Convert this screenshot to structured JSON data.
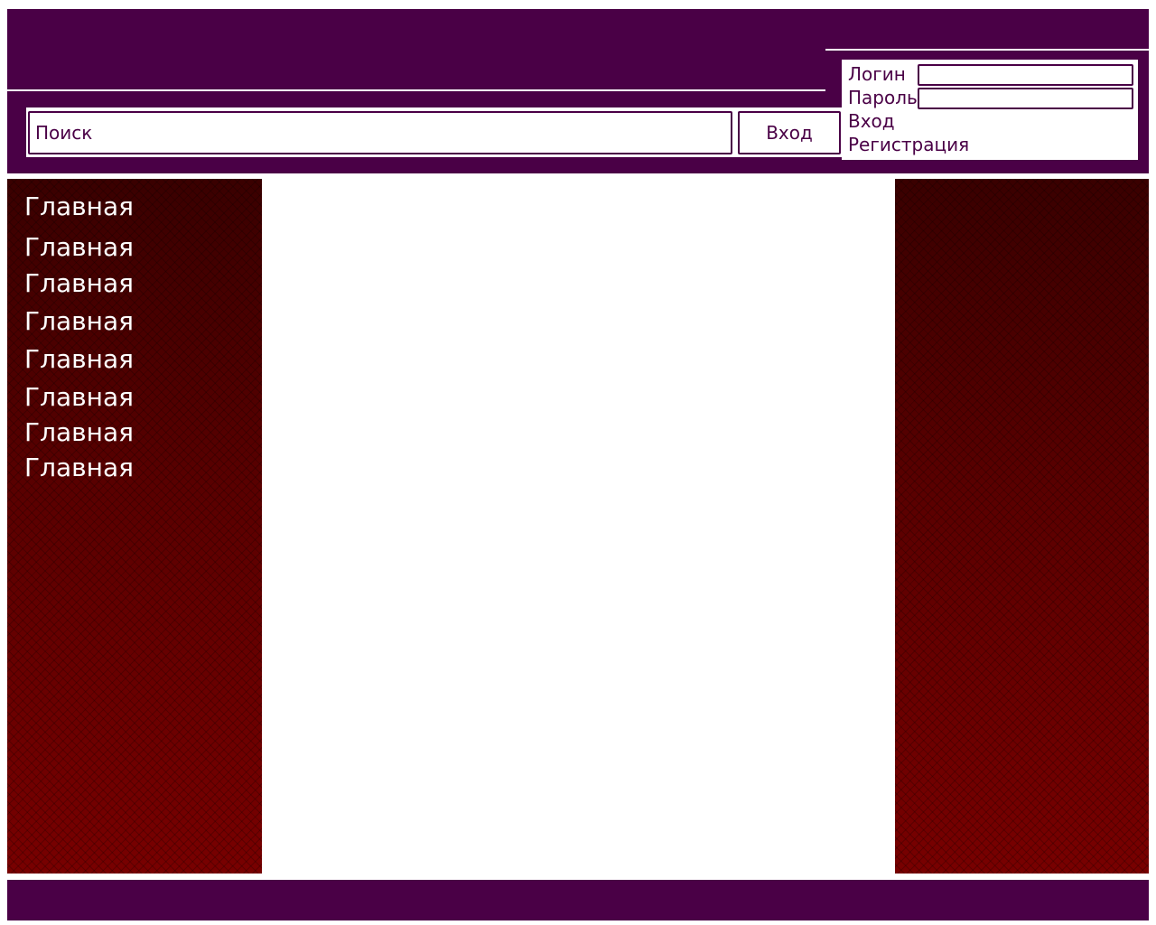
{
  "colors": {
    "brand": "#4a0046",
    "sidebar_dark": "#3a0000",
    "sidebar_light": "#780000",
    "nav_text": "#ffffff"
  },
  "search": {
    "placeholder": "Поиск",
    "button_label": "Вход"
  },
  "login_panel": {
    "login_label": "Логин",
    "password_label": "Пароль",
    "login_link": "Вход",
    "register_link": "Регистрация"
  },
  "sidebar": {
    "items": [
      {
        "label": "Главная"
      },
      {
        "label": "Главная"
      },
      {
        "label": "Главная"
      },
      {
        "label": "Главная"
      },
      {
        "label": "Главная"
      },
      {
        "label": "Главная"
      },
      {
        "label": "Главная"
      },
      {
        "label": "Главная"
      }
    ]
  }
}
